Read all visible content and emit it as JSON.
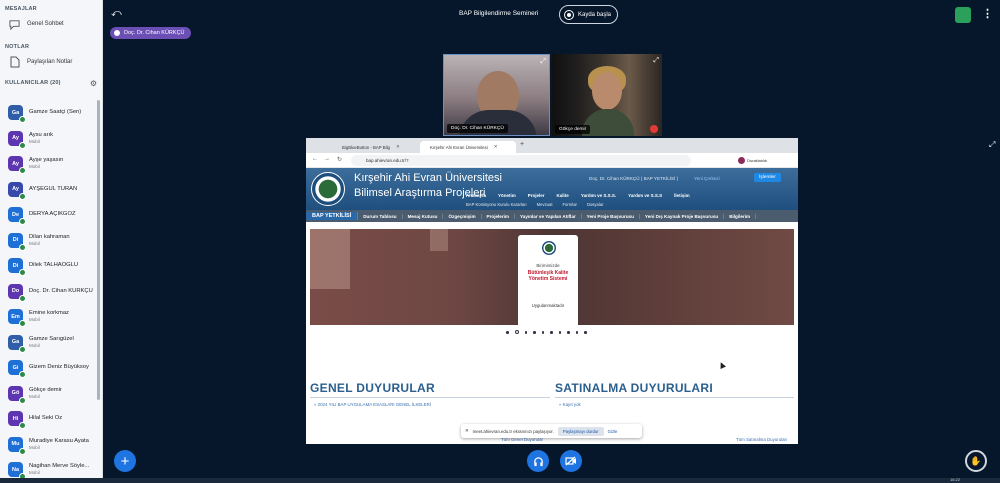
{
  "sidebar": {
    "messages_title": "MESAJLAR",
    "public_chat": "Genel Sohbet",
    "notes_title": "NOTLAR",
    "shared_notes": "Paylaşılan Notlar",
    "users_title": "KULLANICILAR (20)",
    "users": [
      {
        "initials": "Ga",
        "name": "Gamze Saatçi (Sen)",
        "sub": "",
        "color": "#2f5da8"
      },
      {
        "initials": "Ay",
        "name": "Aysu arık",
        "sub": "Mobil",
        "color": "#5e35b1"
      },
      {
        "initials": "Ay",
        "name": "Ayşe yaşasın",
        "sub": "Mobil",
        "color": "#5e35b1"
      },
      {
        "initials": "Ay",
        "name": "AYŞEGÜL TURAN",
        "sub": "",
        "color": "#3949ab"
      },
      {
        "initials": "De",
        "name": "DERYA AÇIKGÖZ",
        "sub": "",
        "color": "#1e6fd6"
      },
      {
        "initials": "Di",
        "name": "Dilan kahraman",
        "sub": "Mobil",
        "color": "#1e6fd6"
      },
      {
        "initials": "Di",
        "name": "Dilek TALHAOĞLU",
        "sub": "",
        "color": "#1e6fd6"
      },
      {
        "initials": "Do",
        "name": "Doç. Dr. Cihan KÜRKÇÜ",
        "sub": "",
        "color": "#5e35b1"
      },
      {
        "initials": "Em",
        "name": "Emine korkmaz",
        "sub": "Mobil",
        "color": "#1e6fd6"
      },
      {
        "initials": "Ga",
        "name": "Gamze Sarıgüzel",
        "sub": "Mobil",
        "color": "#2f5da8"
      },
      {
        "initials": "Gi",
        "name": "Gizem Deniz Büyüksoy",
        "sub": "",
        "color": "#1e6fd6"
      },
      {
        "initials": "Gö",
        "name": "Gökçe demir",
        "sub": "Mobil",
        "color": "#5e35b1"
      },
      {
        "initials": "Hi",
        "name": "Hilal Seki Öz",
        "sub": "",
        "color": "#5e35b1"
      },
      {
        "initials": "Mu",
        "name": "Muradiye Karasu Ayata",
        "sub": "Mobil",
        "color": "#1e6fd6"
      },
      {
        "initials": "Na",
        "name": "Nagihan Merve Söyle...",
        "sub": "Mobil",
        "color": "#1e6fd6"
      }
    ]
  },
  "topbar": {
    "session_title": "BAP Bilgilendirme Semineri",
    "record_label": "Kayda başla",
    "presenter": "Doç. Dr. Cihan KÜRKÇÜ"
  },
  "cams": {
    "cam1_label": "Doç. Dr. Cihan KÜRKÇÜ",
    "cam2_label": "Gökçe demir"
  },
  "browser": {
    "tab1": "BigBlueButton - BAP Bilg",
    "tab2": "Kırşehir Ahi Evran Üniversitesi",
    "url": "bap.ahievran.edu.tr/?",
    "profile": "Duraklatıldı"
  },
  "site": {
    "title1": "Kırşehir Ahi Evran Üniversitesi",
    "title2": "Bilimsel Araştırma Projeleri",
    "user": "Doç. Dr. Cihan KÜRKÇÜ  ( BAP YETKİLİSİ )",
    "logout": "Yeni Çerkezi",
    "actions": "İşlemler",
    "menu": [
      "Anasayfa",
      "Yönetim",
      "Projeler",
      "Kalite",
      "Yardım ve S.S.S.",
      "Yardım ve S.S.S",
      "İletişim"
    ],
    "submenu": [
      "BAP Komisyonu Kurulu Kararları",
      "Mevzuat",
      "Formlar",
      "Dosyalar"
    ],
    "nav": [
      "BAP YETKİLİSİ",
      "Durum Tablosu",
      "Mesaj Kutusu",
      "Özgeçmişim",
      "Projelerim",
      "Yayınlar ve Yapılan Atıflar",
      "Yeni Proje Başvurusu",
      "Yeni Dış Kaynak Proje Başvurusu",
      "Bilgilerim"
    ],
    "banner_line1": "Birimimizde",
    "banner_line2": "Bütünleşik Kalite Yönetim Sistemi",
    "banner_line3": "Uygulanmaktadır",
    "genel_title": "GENEL DUYURULAR",
    "genel_entry": "2024 YILI BAP UYGULAMA ESASLARI GENEL İLKELERİ",
    "genel_link": "Tüm Genel Duyurular",
    "satin_title": "SATINALMA DUYURULARI",
    "satin_entry": "Kayıt yok",
    "satin_link": "Tüm Satınalma Duyuruları"
  },
  "share_toast": {
    "text": "meet.ahievran.edu.tr ekranınızı paylaşıyor.",
    "stop": "Paylaşmayı durdur",
    "hide": "Gizle"
  },
  "clock": "16:22"
}
